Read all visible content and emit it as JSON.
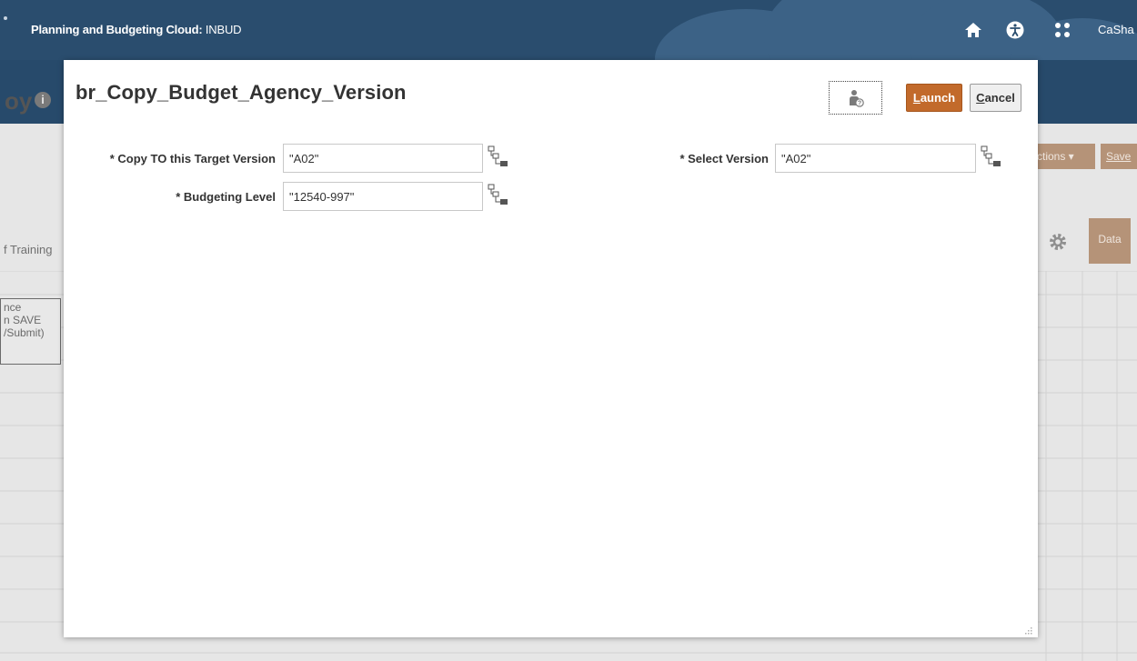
{
  "topbar": {
    "app_title_bold": "Planning and Budgeting Cloud:",
    "app_title_env": "INBUD",
    "user_name": "CaSha",
    "colors": {
      "navy": "#2a4d6e",
      "cloud": "#3c6286"
    }
  },
  "background_page": {
    "title_fragment": "oy",
    "actions_label": "ctions ▾",
    "save_label": "Save",
    "tab_fragment": "f Training",
    "data_button": "Data",
    "cell_lines": [
      "nce",
      "n SAVE",
      "/Submit)"
    ]
  },
  "dialog": {
    "title": "br_Copy_Budget_Agency_Version",
    "launch_label": "Launch",
    "cancel_label": "Cancel",
    "help_icon": "user-help-icon",
    "accent_color": "#c26a2b",
    "fields": [
      {
        "label": "* Copy TO this Target Version",
        "value": "\"A02\""
      },
      {
        "label": "* Budgeting Level",
        "value": "\"12540-997\""
      },
      {
        "label": "* Select Version",
        "value": "\"A02\""
      }
    ],
    "member_selector_icon": "member-selector-icon"
  }
}
